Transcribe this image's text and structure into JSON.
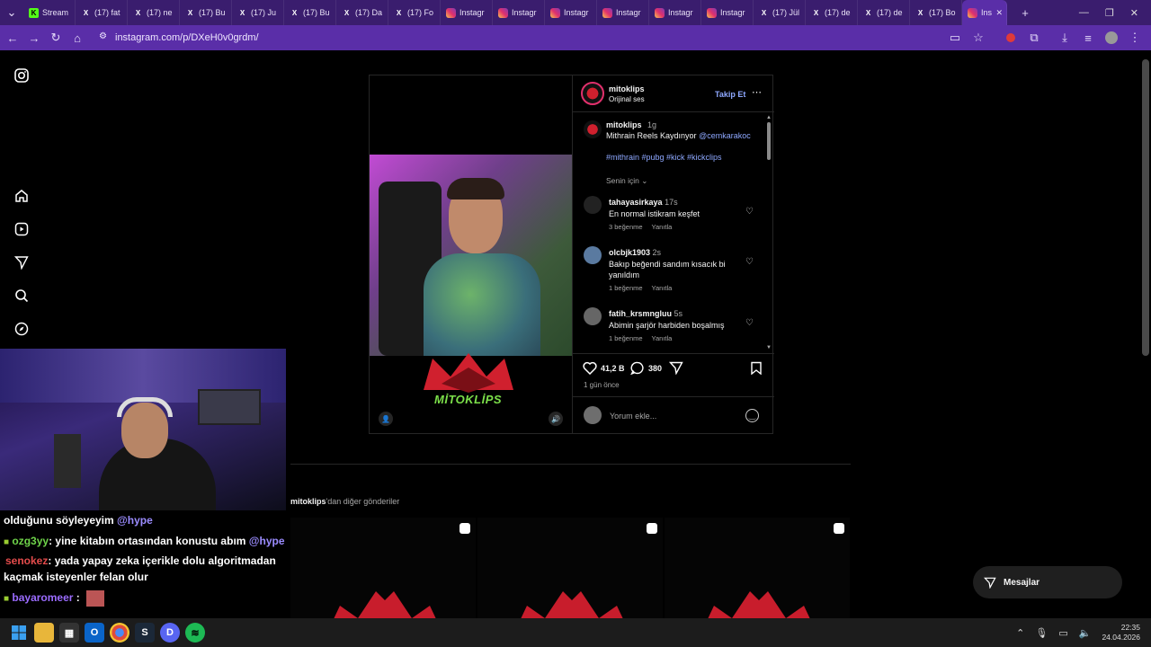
{
  "browser": {
    "tabs": [
      {
        "icon": "kick-favicon",
        "label": "Stream"
      },
      {
        "icon": "x-favicon",
        "label": "(17) fat"
      },
      {
        "icon": "x-favicon",
        "label": "(17) ne"
      },
      {
        "icon": "x-favicon",
        "label": "(17) Bu"
      },
      {
        "icon": "x-favicon",
        "label": "(17) Ju"
      },
      {
        "icon": "x-favicon",
        "label": "(17) Bu"
      },
      {
        "icon": "x-favicon",
        "label": "(17) Da"
      },
      {
        "icon": "x-favicon",
        "label": "(17) Fo"
      },
      {
        "icon": "instagram-favicon",
        "label": "Instagr"
      },
      {
        "icon": "instagram-favicon",
        "label": "Instagr"
      },
      {
        "icon": "instagram-favicon",
        "label": "Instagr"
      },
      {
        "icon": "instagram-favicon",
        "label": "Instagr"
      },
      {
        "icon": "instagram-favicon",
        "label": "Instagr"
      },
      {
        "icon": "instagram-favicon",
        "label": "Instagr"
      },
      {
        "icon": "x-favicon",
        "label": "(17) Jül"
      },
      {
        "icon": "x-favicon",
        "label": "(17) de"
      },
      {
        "icon": "x-favicon",
        "label": "(17) de"
      },
      {
        "icon": "x-favicon",
        "label": "(17) Bo"
      }
    ],
    "active_tab": {
      "label": "Ins"
    },
    "url": "instagram.com/p/DXeH0v0grdm/"
  },
  "post": {
    "author": "mitoklips",
    "audio": "Orijinal ses",
    "follow_label": "Takip Et",
    "caption_author": "mitoklips",
    "caption_time": "1g",
    "caption_text": "Mithrain Reels Kaydınyor",
    "caption_mention": "@cemkarakoc",
    "hashtags": "#mithrain #pubg #kick #kickclips",
    "filter_label": "Senin için",
    "logo_text": "MİTOKLİPS",
    "comments": [
      {
        "user": "tahayasirkaya",
        "time": "17s",
        "text": "En normal istikram keşfet",
        "likes": "3 beğenme",
        "reply": "Yanıtla"
      },
      {
        "user": "olcbjk1903",
        "time": "2s",
        "text": "Bakıp beğendi sandım kısacık bi yanıldım",
        "likes": "1 beğenme",
        "reply": "Yanıtla"
      },
      {
        "user": "fatih_krsmngluu",
        "time": "5s",
        "text": "Abimin şarjör harbiden boşalmış",
        "likes": "1 beğenme",
        "reply": "Yanıtla"
      }
    ],
    "like_count": "41,2 B",
    "comment_count": "380",
    "posted_ago": "1 gün önce",
    "comment_placeholder": "Yorum ekle..."
  },
  "more_posts": {
    "author": "mitoklips",
    "suffix": "'dan diğer gönderiler"
  },
  "messages_button": "Mesajlar",
  "chat": {
    "lines": [
      {
        "user": "",
        "text": "olduğunu söyleyeyim",
        "mention": "@hype"
      },
      {
        "user": "ozg3yy",
        "text": ": yine kitabın ortasından konustu abım",
        "mention": "@hype"
      },
      {
        "user": "senokez",
        "text": ": yada yapay zeka içerikle dolu algoritmadan",
        "mention": ""
      },
      {
        "user": "",
        "text": "kaçmak isteyenler felan olur",
        "mention": ""
      },
      {
        "user": "bayaromeer",
        "text": " :",
        "mention": ""
      }
    ]
  },
  "taskbar": {
    "time": "22:35",
    "date": "24.04.2026"
  },
  "colors": {
    "tabstrip": "#3a1d6e",
    "toolbar": "#5a2ea8",
    "link": "#8ea8ff",
    "follow": "#8ea8ff"
  }
}
